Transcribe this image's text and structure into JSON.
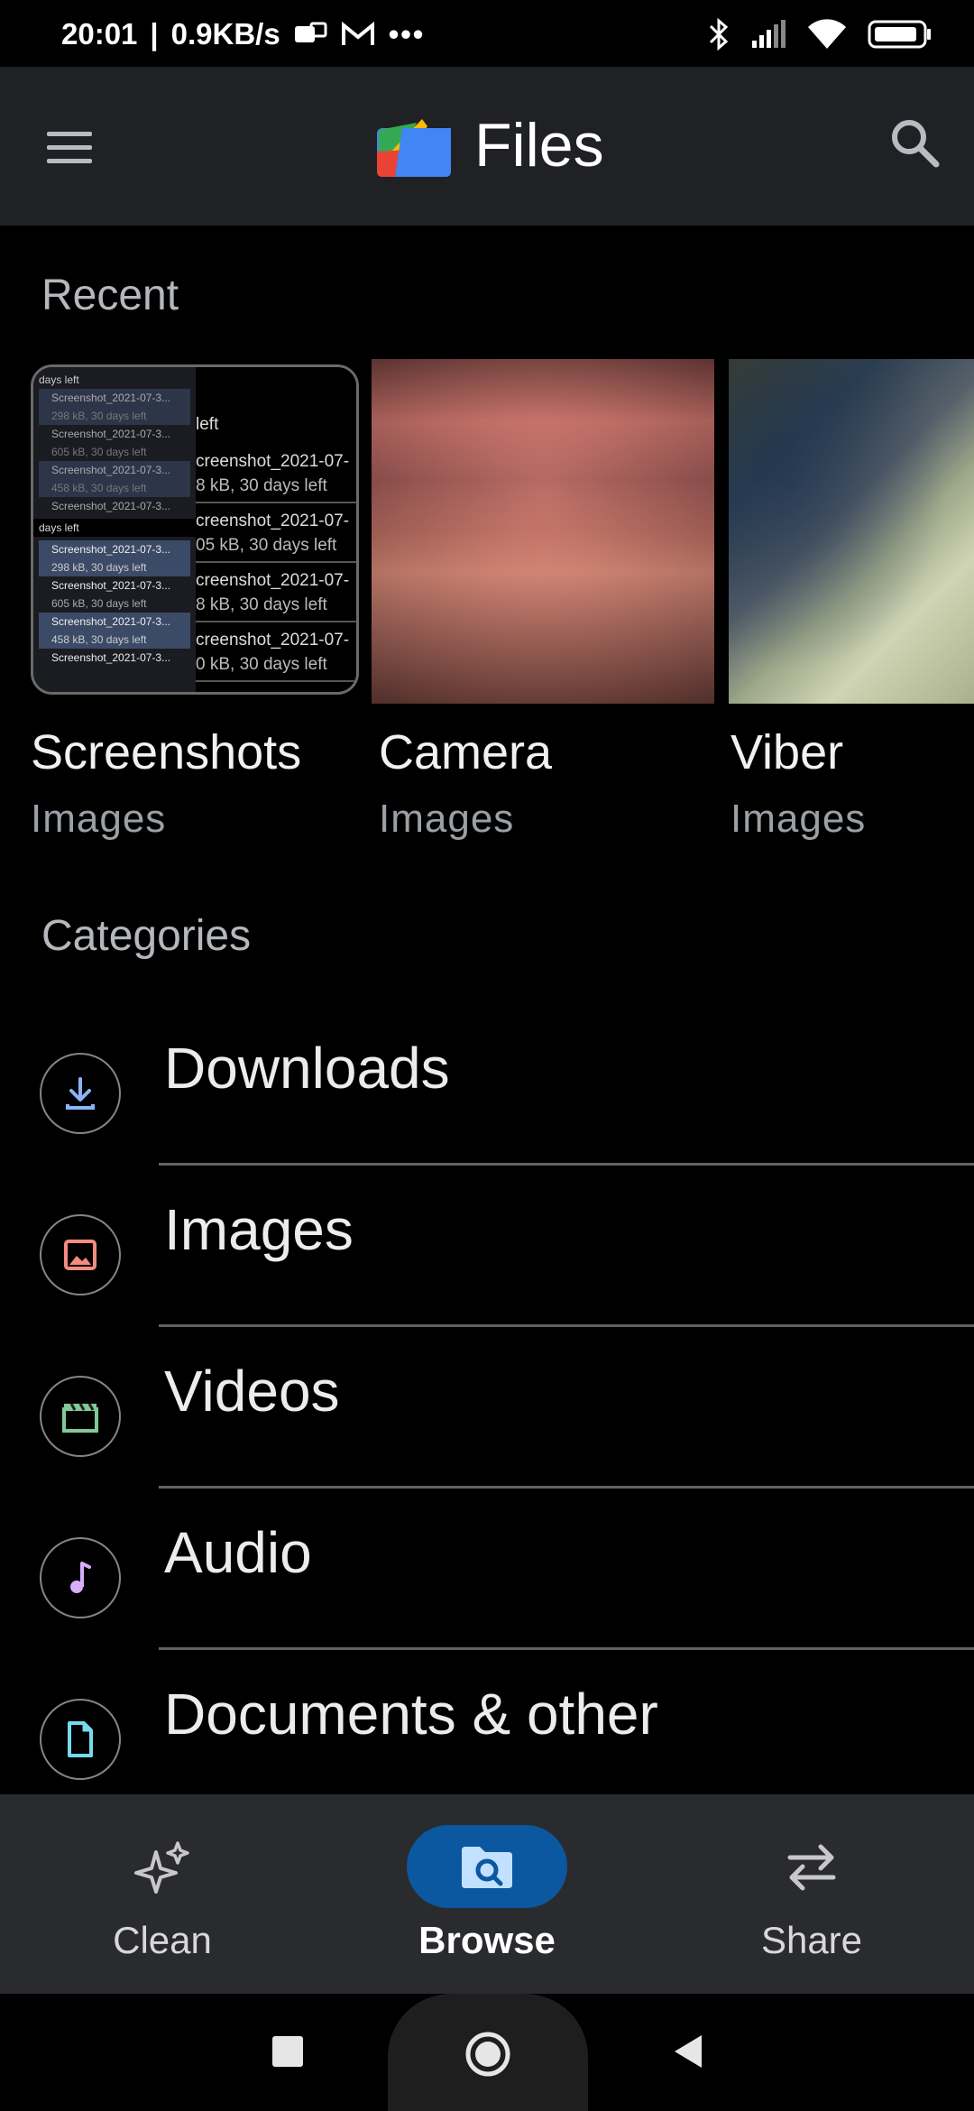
{
  "status": {
    "time": "20:01",
    "speed": "0.9KB/s",
    "more": "•••"
  },
  "app_bar": {
    "title": "Files"
  },
  "recent": {
    "title": "Recent",
    "items": [
      {
        "name": "Screenshots",
        "type": "Images"
      },
      {
        "name": "Camera",
        "type": "Images"
      },
      {
        "name": "Viber",
        "type": "Images"
      }
    ],
    "screenshot_thumb": {
      "left_col": [
        "days left",
        "Screenshot_2021-07-3...",
        "298 kB, 30 days left",
        "Screenshot_2021-07-3...",
        "605 kB, 30 days left",
        "Screenshot_2021-07-3...",
        "458 kB, 30 days left",
        "Screenshot_2021-07-3...",
        "days left",
        "Screenshot_2021-07-3...",
        "298 kB, 30 days left",
        "Screenshot_2021-07-3...",
        "605 kB, 30 days left",
        "Screenshot_2021-07-3...",
        "458 kB, 30 days left",
        "Screenshot_2021-07-3..."
      ],
      "right_col": [
        "left",
        "creenshot_2021-07-",
        "8 kB, 30 days left",
        "creenshot_2021-07-",
        "05 kB, 30 days left",
        "creenshot_2021-07-",
        "8 kB, 30 days left",
        "creenshot_2021-07-",
        "0 kB, 30 days left"
      ]
    }
  },
  "categories": {
    "title": "Categories",
    "items": [
      {
        "label": "Downloads",
        "icon": "download-icon",
        "color": "#8ab4f8"
      },
      {
        "label": "Images",
        "icon": "image-icon",
        "color": "#f28b82"
      },
      {
        "label": "Videos",
        "icon": "video-icon",
        "color": "#81c995"
      },
      {
        "label": "Audio",
        "icon": "audio-icon",
        "color": "#d7aefb"
      },
      {
        "label": "Documents & other",
        "icon": "document-icon",
        "color": "#78d9ec"
      }
    ]
  },
  "bottom_nav": {
    "items": [
      {
        "label": "Clean",
        "icon": "sparkle-icon"
      },
      {
        "label": "Browse",
        "icon": "browse-folder-icon",
        "selected": true
      },
      {
        "label": "Share",
        "icon": "swap-arrows-icon"
      }
    ],
    "accent": "#0b57a0"
  }
}
